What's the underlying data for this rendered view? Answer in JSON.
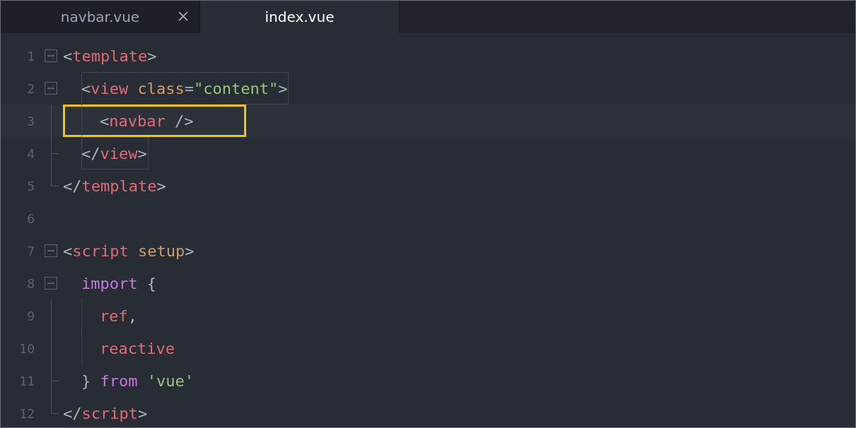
{
  "tabs": [
    {
      "label": "navbar.vue",
      "selected": false,
      "closable": true
    },
    {
      "label": "index.vue",
      "selected": true,
      "closable": false
    }
  ],
  "editor": {
    "lines": [
      {
        "number": "1",
        "kind": "fold",
        "expanded": true,
        "tokens": [
          {
            "kind": "punct",
            "text": "<"
          },
          {
            "kind": "tag",
            "text": "template"
          },
          {
            "kind": "punct",
            "text": ">"
          }
        ],
        "children": [
          {
            "number": "2",
            "kind": "fold",
            "expanded": true,
            "matched": true,
            "tokens": [
              {
                "kind": "punct",
                "text": "<"
              },
              {
                "kind": "tag",
                "text": "view"
              },
              {
                "kind": "attr",
                "text": " class"
              },
              {
                "kind": "punct",
                "text": "="
              },
              {
                "kind": "string",
                "text": "\"content\""
              },
              {
                "kind": "punct",
                "text": ">"
              }
            ],
            "children": [
              {
                "number": "3",
                "kind": "line",
                "highlighted": true,
                "tokens": [
                  {
                    "kind": "punct",
                    "text": "<"
                  },
                  {
                    "kind": "tag",
                    "text": "navbar"
                  },
                  {
                    "kind": "punct",
                    "text": " />"
                  }
                ]
              }
            ]
          },
          {
            "number": "4",
            "kind": "tick",
            "matched": true,
            "tokens": [
              {
                "kind": "punct",
                "text": "</"
              },
              {
                "kind": "tag",
                "text": "view"
              },
              {
                "kind": "punct",
                "text": ">"
              }
            ]
          }
        ]
      },
      {
        "number": "5",
        "kind": "end",
        "tokens": [
          {
            "kind": "punct",
            "text": "</"
          },
          {
            "kind": "tag",
            "text": "template"
          },
          {
            "kind": "punct",
            "text": ">"
          }
        ]
      },
      {
        "number": "6",
        "kind": "none"
      },
      {
        "number": "7",
        "kind": "fold",
        "expanded": true,
        "tokens": [
          {
            "kind": "punct",
            "text": "<"
          },
          {
            "kind": "tag",
            "text": "script"
          },
          {
            "kind": "attr",
            "text": " setup"
          },
          {
            "kind": "punct",
            "text": ">"
          }
        ],
        "children": [
          {
            "number": "8",
            "kind": "fold",
            "expanded": true,
            "tokens": [
              {
                "kind": "keyword",
                "text": "import"
              },
              {
                "kind": "punct",
                "text": " {"
              }
            ],
            "children": [
              {
                "number": "9",
                "kind": "line",
                "tokens": [
                  {
                    "kind": "tag",
                    "text": "ref"
                  },
                  {
                    "kind": "punct",
                    "text": ","
                  }
                ]
              },
              {
                "number": "10",
                "kind": "line",
                "tokens": [
                  {
                    "kind": "tag",
                    "text": "reactive"
                  }
                ]
              }
            ]
          },
          {
            "number": "11",
            "kind": "tick",
            "tokens": [
              {
                "kind": "punct",
                "text": "} "
              },
              {
                "kind": "keyword",
                "text": "from"
              },
              {
                "kind": "string",
                "text": " 'vue'"
              }
            ]
          }
        ]
      },
      {
        "number": "12",
        "kind": "end",
        "tokens": [
          {
            "kind": "punct",
            "text": "</"
          },
          {
            "kind": "tag",
            "text": "script"
          },
          {
            "kind": "punct",
            "text": ">"
          }
        ]
      }
    ]
  }
}
